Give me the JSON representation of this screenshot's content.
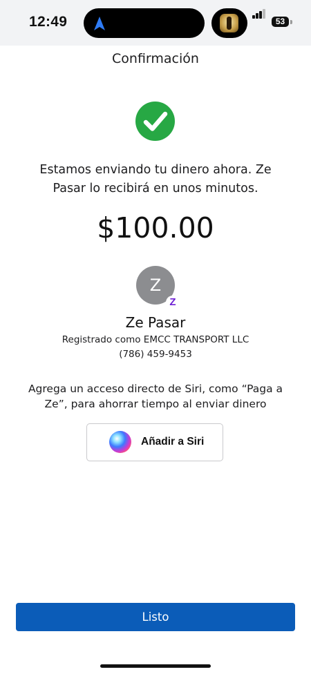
{
  "status_bar": {
    "time": "12:49",
    "battery": "53",
    "icons": [
      "navigation-arrow-icon",
      "app-thumbnail-icon",
      "signal-icon",
      "battery-icon"
    ]
  },
  "header": {
    "title": "Confirmación"
  },
  "main": {
    "message": "Estamos enviando tu dinero ahora. Ze Pasar lo recibirá en unos minutos.",
    "amount": "$100.00",
    "recipient": {
      "initial": "Z",
      "name": "Ze Pasar",
      "registered": "Registrado como EMCC TRANSPORT LLC",
      "phone": "(786) 459-9453",
      "badge": "Z"
    },
    "siri_hint": "Agrega un acceso directo de Siri, como “Paga a Ze”, para ahorrar tiempo al enviar dinero",
    "siri_button_label": "Añadir a Siri"
  },
  "footer": {
    "done_label": "Listo"
  },
  "colors": {
    "accent": "#0b5cb8",
    "success": "#27a844",
    "zelle": "#6d1ed4",
    "avatar": "#8c8d90"
  }
}
